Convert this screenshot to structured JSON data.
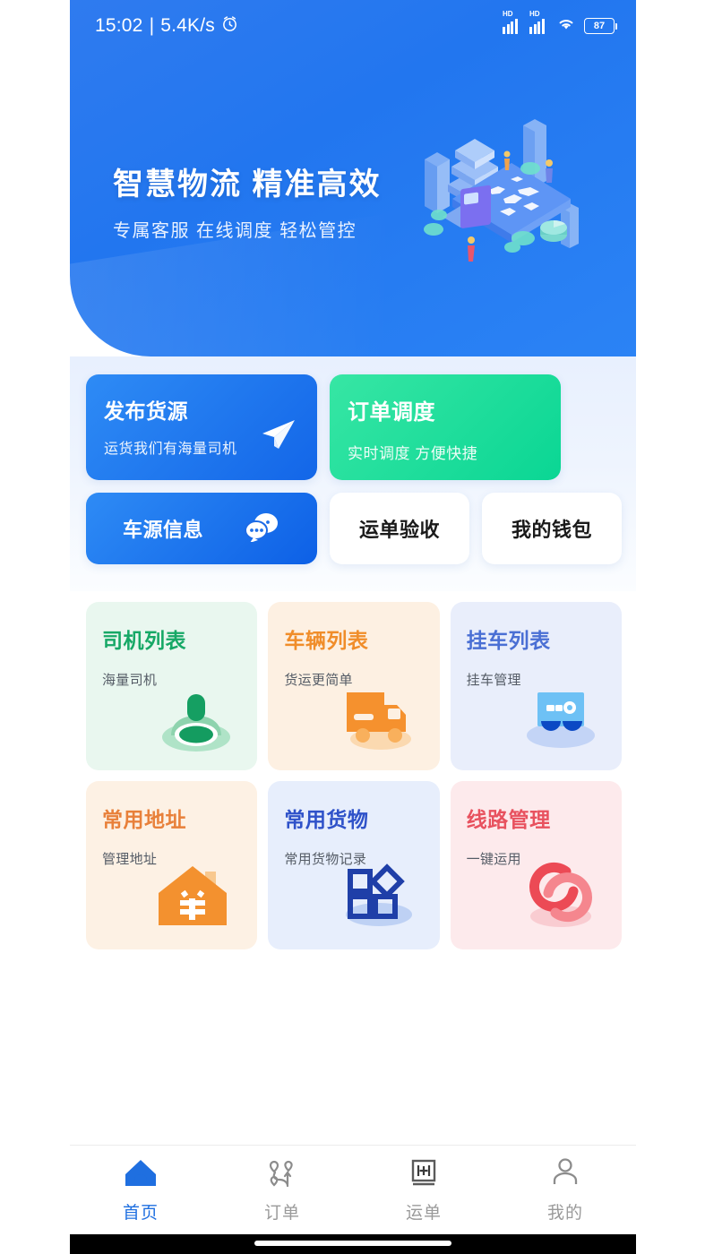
{
  "status_bar": {
    "time": "15:02",
    "separator": "|",
    "network_speed": "5.4K/s",
    "alarm_icon": "alarm-clock-icon",
    "signal_label": "HD",
    "wifi_icon": "wifi-icon",
    "battery_level": "87"
  },
  "banner": {
    "title": "智慧物流  精准高效",
    "subtitle": "专属客服 在线调度 轻松管控",
    "illustration": "isometric-logistics-illustration",
    "bg_color": "#2276ef"
  },
  "quick_actions": [
    {
      "title": "发布货源",
      "subtitle": "运货我们有海量司机",
      "icon": "paper-plane-icon",
      "style": "blue",
      "color": "#1366e8"
    },
    {
      "title": "订单调度",
      "subtitle": "实时调度 方便快捷",
      "icon": "",
      "style": "green",
      "color": "#0ad694"
    },
    {
      "title": "车源信息",
      "subtitle": "",
      "icon": "chat-bubbles-icon",
      "style": "blue-wide",
      "color": "#0d60e6"
    },
    {
      "title": "运单验收",
      "subtitle": "",
      "icon": "",
      "style": "white",
      "color": "#1a1a1a"
    },
    {
      "title": "我的钱包",
      "subtitle": "",
      "icon": "",
      "style": "white",
      "color": "#1a1a1a"
    }
  ],
  "features": [
    {
      "title": "司机列表",
      "subtitle": "海量司机",
      "icon": "driver-icon",
      "theme": "green",
      "title_color": "#16a866",
      "bg": "#e9f7ef"
    },
    {
      "title": "车辆列表",
      "subtitle": "货运更简单",
      "icon": "truck-icon",
      "theme": "orange",
      "title_color": "#f08d2a",
      "bg": "#fdf0e2"
    },
    {
      "title": "挂车列表",
      "subtitle": "挂车管理",
      "icon": "trailer-icon",
      "theme": "blue",
      "title_color": "#4a6fd4",
      "bg": "#e9eefb"
    },
    {
      "title": "常用地址",
      "subtitle": "管理地址",
      "icon": "house-yen-icon",
      "theme": "peach",
      "title_color": "#e8803a",
      "bg": "#fdf1e4"
    },
    {
      "title": "常用货物",
      "subtitle": "常用货物记录",
      "icon": "blocks-icon",
      "theme": "indigo",
      "title_color": "#2f52c9",
      "bg": "#e7eefc"
    },
    {
      "title": "线路管理",
      "subtitle": "一键运用",
      "icon": "linked-rings-icon",
      "theme": "pink",
      "title_color": "#e8525f",
      "bg": "#fdeaec"
    }
  ],
  "tabbar": {
    "active_color": "#1f6fe0",
    "inactive_color": "#9a9a9a",
    "items": [
      {
        "label": "首页",
        "icon": "home-icon",
        "active": true
      },
      {
        "label": "订单",
        "icon": "route-pins-icon",
        "active": false
      },
      {
        "label": "运单",
        "icon": "waybill-box-icon",
        "active": false
      },
      {
        "label": "我的",
        "icon": "person-icon",
        "active": false
      }
    ]
  }
}
